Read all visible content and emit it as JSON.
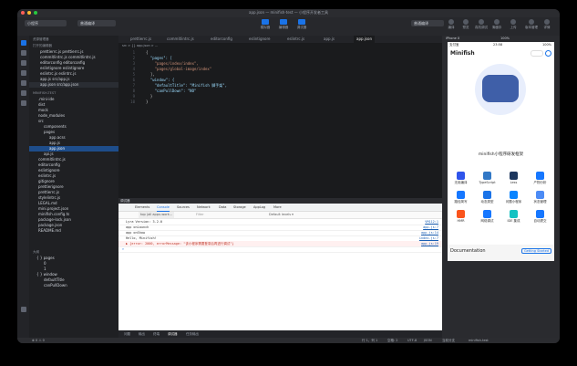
{
  "window": {
    "title": "app.json — minifish-test — 小程序开发者工具"
  },
  "toolbar": {
    "mode": "小程序",
    "compile_mode": "普通编译",
    "left_buttons": [
      "模拟器",
      "编辑器",
      "调试器"
    ],
    "compile_select": "普通编译",
    "right_buttons": [
      "编译",
      "预览",
      "真机调试",
      "清缓存",
      "上传",
      "版本管理",
      "详情"
    ]
  },
  "explorer": {
    "header": "资源管理器",
    "open_editors": "打开的编辑器",
    "open_files": [
      "prettierrc.js  prettierrc.js",
      "commitlintrc.js  commitlintrc.js",
      "editorconfig  editorconfig",
      "eslintignore  eslintignore",
      "eslintrc.js  eslintrc.js",
      "app.js  src/app.js",
      "app.json  src/app.json"
    ],
    "project": "MINIFISH-TEST",
    "tree": [
      ".mini-ide",
      "dist",
      "mock",
      "node_modules",
      "src",
      "components",
      "pages",
      "app.acss",
      "app.js",
      "app.json",
      "api.js",
      "commitlintrc.js",
      "editorconfig",
      "eslintignore",
      "eslintrc.js",
      "gitignore",
      "prettierignore",
      "prettierrc.js",
      "stylelintrc.js",
      "LEGAL.md",
      "mini.project.json",
      "minifish.config.ts",
      "package-lock.json",
      "package.json",
      "README.md"
    ]
  },
  "outline": {
    "header": "大纲",
    "items": [
      "{ } pages",
      "0",
      "1",
      "{ } window",
      "defaultTitle",
      "canPullDown"
    ]
  },
  "editor": {
    "tabs": [
      "prettierrc.js",
      "commitlintrc.js",
      "editorconfig",
      "eslintignore",
      "eslintrc.js",
      "app.js",
      "app.json"
    ],
    "breadcrumb": "src > {} app.json > ...",
    "lines": [
      "{",
      "  \"pages\": [",
      "    \"pages/index/index\",",
      "    \"pages/global-image/index\"",
      "  ],",
      "  \"window\": {",
      "    \"defaultTitle\": \"Minifish 脚手架\",",
      "    \"canPullDown\": \"NO\"",
      "  }",
      "}"
    ]
  },
  "debug": {
    "header": "调试器",
    "tabs": [
      "Elements",
      "Console",
      "Sources",
      "Network",
      "Data",
      "Storage",
      "AppLog",
      "More"
    ],
    "context": "top (all appx-work...",
    "filter_placeholder": "Filter",
    "levels": "Default levels ▾",
    "logs": [
      {
        "text": "Lyra Version: 3.2.0",
        "src": "VM112:1"
      },
      {
        "text": "app onLaunch",
        "src": "app.js:7"
      },
      {
        "text": "app onShow",
        "src": "app.js:14"
      },
      {
        "text": "Hello, Minifish!",
        "src": "index.js:7"
      },
      {
        "text": "▶ {error: 2000, errorMessage: \"该小程序需要登录后再进行调试\"}",
        "src": "app.js:19",
        "error": true
      },
      {
        "text": ">",
        "src": ""
      }
    ]
  },
  "bottom_tabs": [
    "问题",
    "输出",
    "终端",
    "调试器",
    "任务输出"
  ],
  "statusbar": {
    "left": "⊗ 0 ⚠ 0",
    "right": [
      "行 1，列 1",
      "空格: 2",
      "UTF-8",
      "JSON",
      "当前分支",
      "minifish-test"
    ]
  },
  "simulator": {
    "device": "iPhone X",
    "zoom": "100%",
    "carrier": "支付宝",
    "time": "23:58",
    "battery": "100%",
    "app_name": "Minifish",
    "hero_title": "minifish小程序研发框架",
    "grid": [
      {
        "label": "无用编译",
        "color": "#2f54eb"
      },
      {
        "label": "TypeScript",
        "color": "#3178c6"
      },
      {
        "label": "Less",
        "color": "#1d365d"
      },
      {
        "label": "产物分析",
        "color": "#1677ff"
      },
      {
        "label": "路径简写",
        "color": "#1677ff"
      },
      {
        "label": "动态类型",
        "color": "#1a73e8"
      },
      {
        "label": "问题小程序",
        "color": "#0a84ff"
      },
      {
        "label": "状态管理",
        "color": "#4c8bf5"
      },
      {
        "label": "HMR",
        "color": "#fa541c"
      },
      {
        "label": "网络调试",
        "color": "#1677ff"
      },
      {
        "label": "IDE 集成",
        "color": "#13c2c2"
      },
      {
        "label": "自动提交",
        "color": "#1677ff"
      }
    ],
    "doc_label": "Documentation",
    "doc_button": "Getting Started"
  }
}
